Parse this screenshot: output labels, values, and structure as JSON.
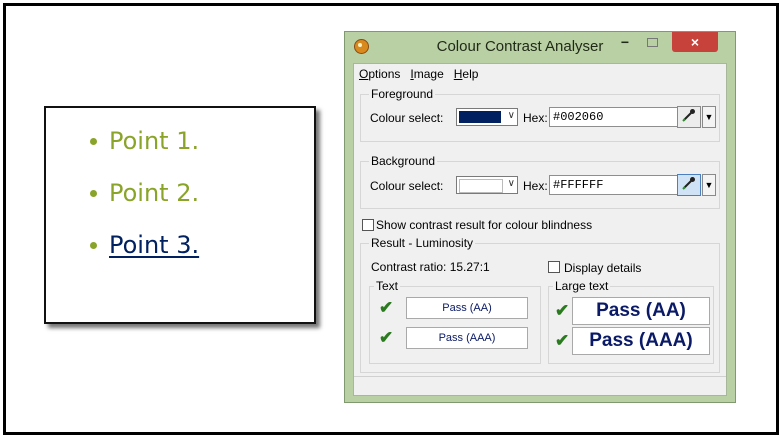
{
  "slide": {
    "bullets": [
      {
        "text": "Point 1."
      },
      {
        "text": "Point 2."
      },
      {
        "text": "Point 3."
      }
    ]
  },
  "window": {
    "title": "Colour Contrast Analyser",
    "close_glyph": "×",
    "minimize_glyph": "−",
    "menu": [
      "Options",
      "Image",
      "Help"
    ],
    "foreground": {
      "legend": "Foreground",
      "colour_select_label": "Colour select:",
      "swatch_color": "#002060",
      "hex_label": "Hex:",
      "hex_value": "#002060"
    },
    "background": {
      "legend": "Background",
      "colour_select_label": "Colour select:",
      "swatch_color": "#FFFFFF",
      "hex_label": "Hex:",
      "hex_value": "#FFFFFF"
    },
    "colour_blindness_label": "Show contrast result for colour blindness",
    "result": {
      "legend": "Result - Luminosity",
      "contrast_ratio": "Contrast ratio: 15.27:1",
      "display_details_label": "Display details",
      "text_legend": "Text",
      "large_text_legend": "Large text",
      "text_aa": "Pass (AA)",
      "text_aaa": "Pass (AAA)",
      "large_aa": "Pass (AA)",
      "large_aaa": "Pass (AAA)"
    }
  },
  "colors": {
    "bullet_green": "#8aa42a",
    "link_navy": "#002060",
    "window_frame": "#b9cfa4",
    "close_red": "#c7423a",
    "pass_tick": "#2a7a1e"
  }
}
